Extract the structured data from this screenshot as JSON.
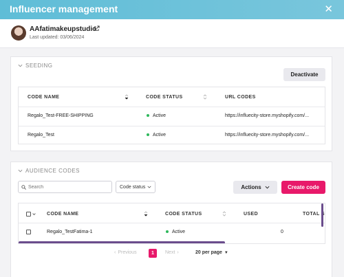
{
  "header": {
    "title": "Influencer management"
  },
  "profile": {
    "name": "AAfatimakeupstudio",
    "last_updated": "Last updated: 03/06/2024"
  },
  "seeding": {
    "section_label": "SEEDING",
    "deactivate_label": "Deactivate",
    "columns": [
      "CODE NAME",
      "CODE STATUS",
      "URL CODES"
    ],
    "rows": [
      {
        "code_name": "Regalo_Test-FREE-SHIPPING",
        "status": "Active",
        "url": "https://influecity-store.myshopify.com/..."
      },
      {
        "code_name": "Regalo_Test",
        "status": "Active",
        "url": "https://influecity-store.myshopify.com/..."
      }
    ]
  },
  "audience": {
    "section_label": "AUDIENCE CODES",
    "search_placeholder": "Search",
    "status_filter_label": "Code status",
    "actions_label": "Actions",
    "create_label": "Create code",
    "columns": [
      "CODE NAME",
      "CODE STATUS",
      "USED",
      "TOTAL S"
    ],
    "rows": [
      {
        "code_name": "Regalo_TestFatima-1",
        "status": "Active",
        "used": "0"
      }
    ]
  },
  "pagination": {
    "previous_label": "Previous",
    "current_page": "1",
    "next_label": "Next",
    "per_page_label": "20 per page"
  },
  "colors": {
    "header_start": "#5fbdd7",
    "header_end": "#79c6dc",
    "accent": "#e8196a",
    "active_dot": "#2eb85c",
    "scrollbar": "#6a4c8c"
  }
}
